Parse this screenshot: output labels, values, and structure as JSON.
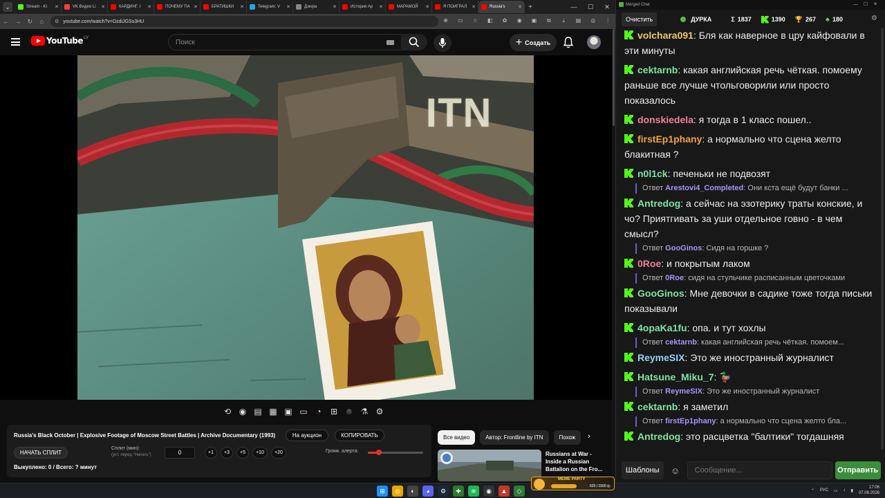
{
  "browser": {
    "tabs": [
      {
        "label": "Stream - Ki",
        "color": "#53fc18"
      },
      {
        "label": "VK Видео Li",
        "color": "#ff3b3b"
      },
      {
        "label": "КАРДИНГ. I",
        "color": "#ff0000"
      },
      {
        "label": "ПОЧЕМУ ПА",
        "color": "#ff0000"
      },
      {
        "label": "БРАТИШКИ",
        "color": "#ff0000"
      },
      {
        "label": "Telegram: V",
        "color": "#2aa3e0"
      },
      {
        "label": "Дзюра",
        "color": "#888888"
      },
      {
        "label": "История Ар",
        "color": "#ff0000"
      },
      {
        "label": "МАРАМОЙ",
        "color": "#ff0000"
      },
      {
        "label": "Я ПОИГРАЛ",
        "color": "#ff0000"
      },
      {
        "label": "Russia's",
        "color": "#ff0000",
        "active": true
      }
    ],
    "url": "youtube.com/watch?v=DzdiJGSs3HU"
  },
  "youtube": {
    "logo_text": "YouTube",
    "region": "LV",
    "search_placeholder": "Поиск",
    "create_label": "Создать",
    "watermark": "ITN",
    "video_title": "Russia's Black October | Explosive Footage of Moscow Street Battles | Archive Documentary (1993)",
    "auction_label": "На аукцион",
    "copy_label": "КОПИРОВАТЬ",
    "split_button": "НАЧАТЬ СПЛИТ",
    "split_label": "Сплит (мин):",
    "split_sub": "(уст. перед \"Начать\")",
    "split_value": "0",
    "increments": [
      "+1",
      "+3",
      "+5",
      "+10",
      "+20"
    ],
    "alert_volume_label": "Громк. алерта:",
    "alert_volume_fraction": 0.2,
    "bought_text": "Выкуплено: 0 / Всего: ? минут",
    "chips": [
      {
        "label": "Все видео",
        "active": true
      },
      {
        "label": "Автор: Frontline by ITN",
        "active": false
      },
      {
        "label": "Похож",
        "active": false
      }
    ],
    "rec_title": "Russians at War - Inside a Russian Battalion on the Fro..."
  },
  "chat": {
    "window_title": "Merged Chat",
    "clear_label": "Очистить",
    "channel": "ДУРКА",
    "total": "1837",
    "kick_count": "1390",
    "trophy_count": "267",
    "other_count": "180",
    "templates_label": "Шаблоны",
    "input_placeholder": "Сообщение...",
    "send_label": "Отправить",
    "messages": [
      {
        "user": "volchara091",
        "color": "#f0c96c",
        "text": "Бля как наверное в цру кайфовали в эти минуты"
      },
      {
        "user": "cektarnb",
        "color": "#7fe3a6",
        "text": "какая английская речь чёткая. помоему раньше все лучше чтольговорили или просто показалось"
      },
      {
        "user": "donskiedela",
        "color": "#f07f9a",
        "text": "я тогда в 1 класс пошел.."
      },
      {
        "user": "firstEp1phany",
        "color": "#f5a43b",
        "text": "а нормально что сцена желто блакитная ?"
      },
      {
        "user": "n0l1ck",
        "color": "#7fe3a6",
        "text": "печеньки не подвозят",
        "reply": {
          "user": "Arestovi4_Completed",
          "ucolor": "#a993f7",
          "text": "Они кста ещё будут банки ..."
        }
      },
      {
        "user": "Antredog",
        "color": "#7fe3a6",
        "text": "а сейчас на эзотерику траты конские, и чо? Приятгивать за уши отдельное говно - в чем смысл?",
        "reply": {
          "user": "GooGinos",
          "ucolor": "#a993f7",
          "text": "Сидя на горшке ?"
        }
      },
      {
        "user": "0Roe",
        "color": "#f07f9a",
        "text": "и покрытым лаком",
        "reply": {
          "user": "0Roe",
          "ucolor": "#a993f7",
          "text": "сидя на стульчике расписанным цветочками"
        }
      },
      {
        "user": "GooGinos",
        "color": "#7fe3a6",
        "text": "Мне девочки в садике тоже тогда письки показывали"
      },
      {
        "user": "4opaKa1fu",
        "color": "#7fe3a6",
        "text": "опа. и тут хохлы",
        "reply": {
          "user": "cektarnb",
          "ucolor": "#a993f7",
          "text": "какая английская речь чёткая. помоем..."
        }
      },
      {
        "user": "ReymeSIX",
        "color": "#8fd3f5",
        "text": "Это же иностранный журналист"
      },
      {
        "user": "Hatsune_Miku_7",
        "color": "#7fe3a6",
        "text": "🦆",
        "reply": {
          "user": "ReymeSIX",
          "ucolor": "#a993f7",
          "text": "Это же иностранный журналист"
        }
      },
      {
        "user": "cektarnb",
        "color": "#7fe3a6",
        "text": "я заметил",
        "reply": {
          "user": "firstEp1phany",
          "ucolor": "#a993f7",
          "text": "а нормально что сцена желто бла..."
        }
      },
      {
        "user": "Antredog",
        "color": "#7fe3a6",
        "text": "это расцветка \"балтики\" тогдашняя"
      }
    ],
    "reply_prefix": "Ответ"
  },
  "taskbar": {
    "widget_title": "MEME PARTY",
    "widget_value": "625 / 1500 ◎",
    "widget_progress": 0.42,
    "lang": "РУС",
    "time": "17:06",
    "date": "07.08.2026"
  }
}
